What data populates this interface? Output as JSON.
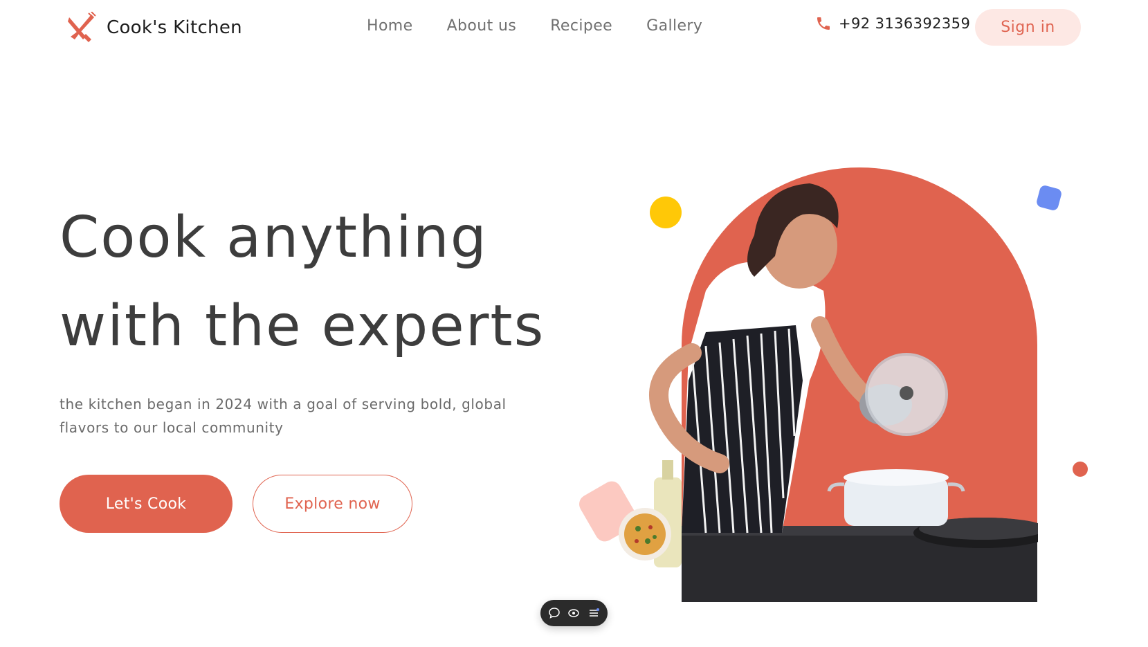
{
  "brand": {
    "name": "Cook's Kitchen",
    "logo_icon": "fork-knife-icon"
  },
  "nav": {
    "items": [
      {
        "label": "Home"
      },
      {
        "label": "About us"
      },
      {
        "label": "Recipee"
      },
      {
        "label": "Gallery"
      }
    ]
  },
  "contact": {
    "phone": "+92 3136392359",
    "icon": "phone-icon"
  },
  "auth": {
    "signin_label": "Sign in"
  },
  "hero": {
    "title_line1": "Cook anything",
    "title_line2": "with the experts",
    "subtitle_line1": "the kitchen began in 2024 with a goal of serving bold, global",
    "subtitle_line2": "flavors to our local community",
    "primary_cta": "Let's Cook",
    "secondary_cta": "Explore now"
  },
  "toolbar": {
    "icons": [
      "comment-icon",
      "eye-icon",
      "menu-icon"
    ]
  },
  "colors": {
    "accent": "#e0634f",
    "accent_light": "#fde8e4",
    "yellow": "#ffc807",
    "blue": "#6b8cf2",
    "pink": "#fcc9c1",
    "text_dark": "#3d3d3d",
    "text_muted": "#6a6a6a"
  }
}
